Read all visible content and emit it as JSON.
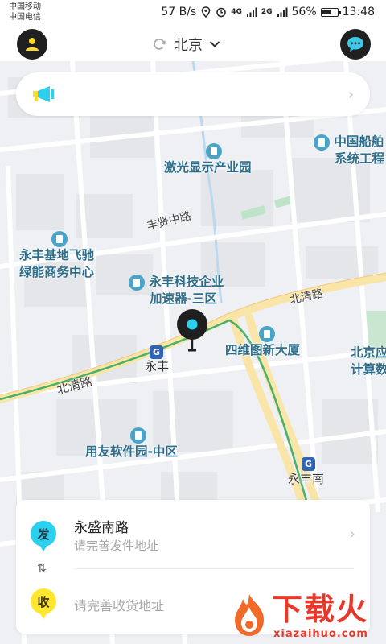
{
  "status_bar": {
    "carrier1": "中国移动",
    "carrier2": "中国电信",
    "speed": "57 B/s",
    "net1": "4G",
    "net2": "2G",
    "battery": "56%",
    "time": "13:48"
  },
  "header": {
    "city": "北京",
    "avatar_icon": "user-icon",
    "chat_icon": "chat-bubble-icon",
    "refresh_icon": "refresh-icon",
    "dropdown_icon": "chevron-down-icon"
  },
  "notice": {
    "icon": "megaphone-icon",
    "chevron": "›"
  },
  "map": {
    "pois": [
      "激光显示产业园",
      "中国船舶",
      "系统工程",
      "永丰基地飞驰",
      "绿能商务中心",
      "永丰科技企业",
      "加速器-三区",
      "四维图新大厦",
      "北京应",
      "计算数",
      "用友软件园-中区"
    ],
    "roads": [
      "丰贤中路",
      "北清路",
      "北清路"
    ],
    "metro": [
      "永丰",
      "永丰南"
    ]
  },
  "card": {
    "send_badge": "发",
    "send_address": "永盛南路",
    "send_hint": "请完善发件地址",
    "swap": "⇅",
    "recv_badge": "收",
    "recv_hint": "请完善收货地址",
    "chevron": "›"
  },
  "watermark": {
    "text": "下载火",
    "url": "xiazaihuo.com"
  },
  "colors": {
    "accent_cyan": "#2ad0ee",
    "accent_yellow": "#ffe62f",
    "poi_blue": "#2f6e8a",
    "watermark_red": "#e7382a"
  }
}
